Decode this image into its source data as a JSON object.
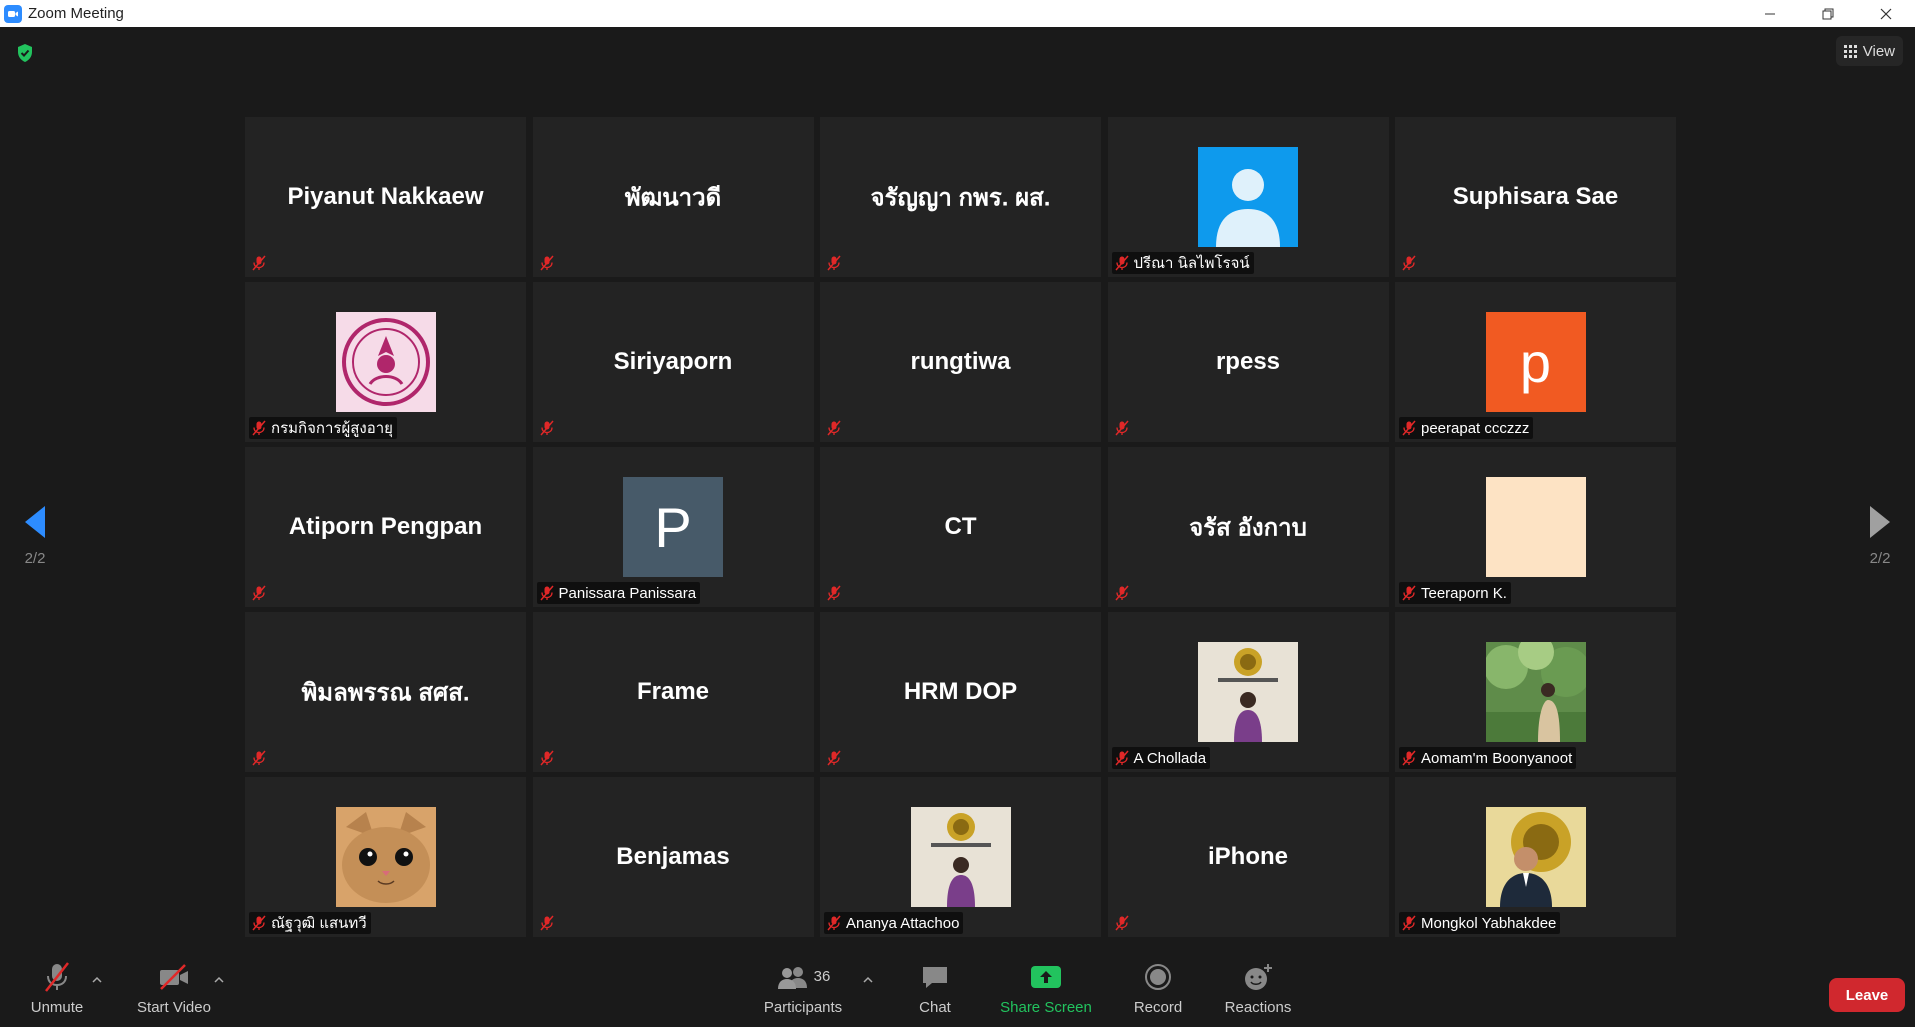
{
  "window": {
    "title": "Zoom Meeting"
  },
  "top_right": {
    "view_label": "View"
  },
  "pagination": {
    "left_page": "2/2",
    "right_page": "2/2"
  },
  "tiles": [
    {
      "name": "Piyanut Nakkaew",
      "label": "",
      "avatar": ""
    },
    {
      "name": "พัฒนาวดี",
      "label": "",
      "avatar": ""
    },
    {
      "name": "จรัญญา  กพร. ผส.",
      "label": "",
      "avatar": ""
    },
    {
      "name": "",
      "label": "ปรีณา นิลไพโรจน์",
      "avatar": "default-person-avatar"
    },
    {
      "name": "Suphisara Sae",
      "label": "",
      "avatar": ""
    },
    {
      "name": "",
      "label": "กรมกิจการผู้สูงอายุ",
      "avatar": "department-seal-avatar"
    },
    {
      "name": "Siriyaporn",
      "label": "",
      "avatar": ""
    },
    {
      "name": "rungtiwa",
      "label": "",
      "avatar": ""
    },
    {
      "name": "rpess",
      "label": "",
      "avatar": ""
    },
    {
      "name": "",
      "label": "peerapat ccczzz",
      "avatar": "letter-avatar",
      "avatar_letter": "p",
      "avatar_color": "#f15a22"
    },
    {
      "name": "Atiporn Pengpan",
      "label": "",
      "avatar": ""
    },
    {
      "name": "",
      "label": "Panissara Panissara",
      "avatar": "letter-avatar",
      "avatar_letter": "P",
      "avatar_color": "#475a69"
    },
    {
      "name": "CT",
      "label": "",
      "avatar": ""
    },
    {
      "name": "จรัส อังกาบ",
      "label": "",
      "avatar": ""
    },
    {
      "name": "",
      "label": "Teeraporn K.",
      "avatar": "solid-avatar",
      "avatar_color": "#fde3c4"
    },
    {
      "name": "พิมลพรรณ สศส.",
      "label": "",
      "avatar": ""
    },
    {
      "name": "Frame",
      "label": "",
      "avatar": ""
    },
    {
      "name": "HRM DOP",
      "label": "",
      "avatar": ""
    },
    {
      "name": "",
      "label": "A Chollada",
      "avatar": "office-photo-avatar"
    },
    {
      "name": "",
      "label": "Aomam'm Boonyanoot",
      "avatar": "nature-photo-avatar"
    },
    {
      "name": "",
      "label": "ณัฐวุฒิ แสนทวี",
      "avatar": "cat-photo-avatar"
    },
    {
      "name": "Benjamas",
      "label": "",
      "avatar": ""
    },
    {
      "name": "",
      "label": "Ananya Attachoo",
      "avatar": "office-photo-avatar"
    },
    {
      "name": "iPhone",
      "label": "",
      "avatar": ""
    },
    {
      "name": "",
      "label": "Mongkol Yabhakdee",
      "avatar": "portrait-photo-avatar"
    }
  ],
  "toolbar": {
    "unmute_label": "Unmute",
    "start_video_label": "Start Video",
    "participants_label": "Participants",
    "participants_count": "36",
    "chat_label": "Chat",
    "share_screen_label": "Share Screen",
    "record_label": "Record",
    "reactions_label": "Reactions",
    "leave_label": "Leave"
  },
  "colors": {
    "background": "#1a1a1a",
    "tile": "#232323",
    "mic_off": "#e02828",
    "share_green": "#22c35e",
    "leave_red": "#d0282e",
    "nav_arrow_active": "#2d8cff",
    "zoom_blue": "#2d8cff"
  },
  "icons": {
    "app": "zoom-logo-icon",
    "security": "shield-check-icon",
    "view": "grid-icon",
    "nav_left": "caret-left-icon",
    "nav_right": "caret-right-icon",
    "tile_mic": "mic-off-icon"
  }
}
